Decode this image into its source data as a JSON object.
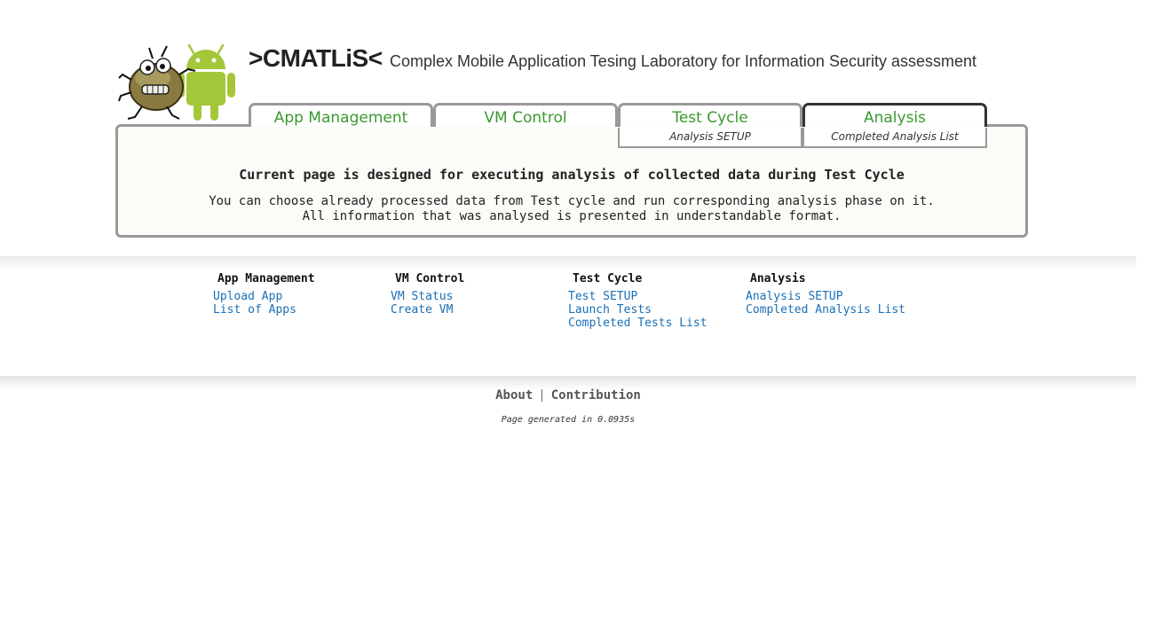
{
  "header": {
    "app_name": ">CMATLiS<",
    "app_description": "Complex Mobile Application Tesing Laboratory for Information Security assessment"
  },
  "tabs": [
    {
      "label": "App Management"
    },
    {
      "label": "VM Control"
    },
    {
      "label": "Test Cycle"
    },
    {
      "label": "Analysis",
      "active": true
    }
  ],
  "subtabs": [
    {
      "label": "Analysis SETUP"
    },
    {
      "label": "Completed Analysis List"
    }
  ],
  "panel": {
    "heading": "Current page is designed for executing analysis of collected data during Test Cycle",
    "line1": "You can choose already processed data from Test cycle and run corresponding analysis phase on it.",
    "line2": "All information that was analysed is presented in understandable format."
  },
  "sitemap": [
    {
      "heading": "App Management",
      "links": [
        "Upload App",
        "List of Apps"
      ]
    },
    {
      "heading": "VM Control",
      "links": [
        "VM Status",
        "Create VM"
      ]
    },
    {
      "heading": "Test Cycle",
      "links": [
        "Test SETUP",
        "Launch Tests",
        "Completed Tests List"
      ]
    },
    {
      "heading": "Analysis",
      "links": [
        "Analysis SETUP",
        "Completed Analysis List"
      ]
    }
  ],
  "footer": {
    "about": "About",
    "separator": "|",
    "contribution": "Contribution",
    "generated": "Page generated in 0.0935s"
  },
  "colors": {
    "tab_text": "#3a9a2e",
    "link": "#1a6fb5",
    "border": "#999999",
    "active_border": "#333333"
  },
  "icons": {
    "logo": "bug-and-android-robot-logo"
  }
}
